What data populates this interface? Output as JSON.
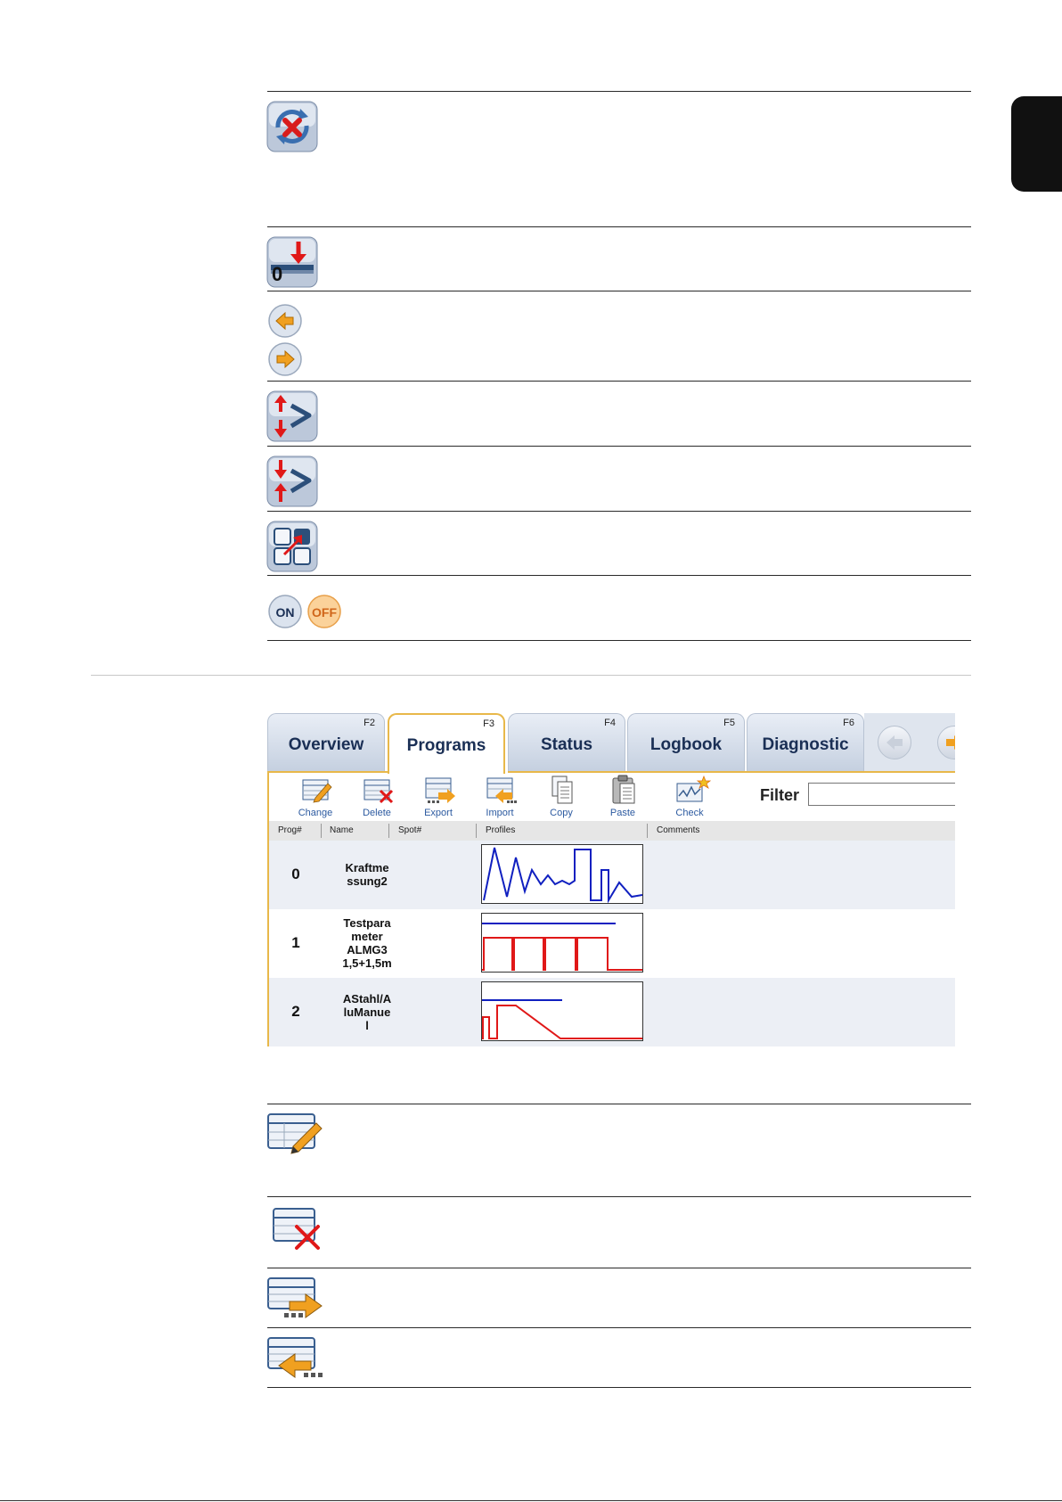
{
  "screenshot": {
    "tabs": [
      {
        "label": "Overview",
        "key": "F2"
      },
      {
        "label": "Programs",
        "key": "F3"
      },
      {
        "label": "Status",
        "key": "F4"
      },
      {
        "label": "Logbook",
        "key": "F5"
      },
      {
        "label": "Diagnostic",
        "key": "F6"
      }
    ],
    "active_tab": "Programs",
    "toolbar": [
      {
        "label": "Change",
        "icon": "change-icon"
      },
      {
        "label": "Delete",
        "icon": "delete-icon"
      },
      {
        "label": "Export",
        "icon": "export-icon"
      },
      {
        "label": "Import",
        "icon": "import-icon"
      },
      {
        "label": "Copy",
        "icon": "copy-icon"
      },
      {
        "label": "Paste",
        "icon": "paste-icon"
      },
      {
        "label": "Check",
        "icon": "check-icon"
      }
    ],
    "filter_label": "Filter",
    "filter_value": "",
    "columns": [
      "Prog#",
      "Name",
      "Spot#",
      "Profiles",
      "Comments"
    ],
    "rows": [
      {
        "prog": "0",
        "name_lines": [
          "Kraftme",
          "ssung2"
        ],
        "spot": "",
        "comments": ""
      },
      {
        "prog": "1",
        "name_lines": [
          "Testpara",
          "meter",
          "ALMG3",
          "1,5+1,5m"
        ],
        "spot": "",
        "comments": ""
      },
      {
        "prog": "2",
        "name_lines": [
          "AStahl/A",
          "luManue",
          "l"
        ],
        "spot": "",
        "comments": ""
      }
    ]
  },
  "icons": {
    "top_list": [
      "sync-cancel-icon",
      "zero-reference-icon",
      "arrow-left-icon",
      "arrow-right-icon",
      "sequence-up-down-icon",
      "sequence-down-up-icon",
      "grid-select-icon",
      "on-icon",
      "off-icon"
    ],
    "bottom_list": [
      "change-icon",
      "delete-icon",
      "export-icon",
      "import-icon"
    ],
    "on_label": "ON",
    "off_label": "OFF"
  },
  "colors": {
    "accent": "#e8b84a",
    "profile_blue": "#1020c0",
    "profile_red": "#e01818",
    "tab_text": "#1a2f55"
  }
}
